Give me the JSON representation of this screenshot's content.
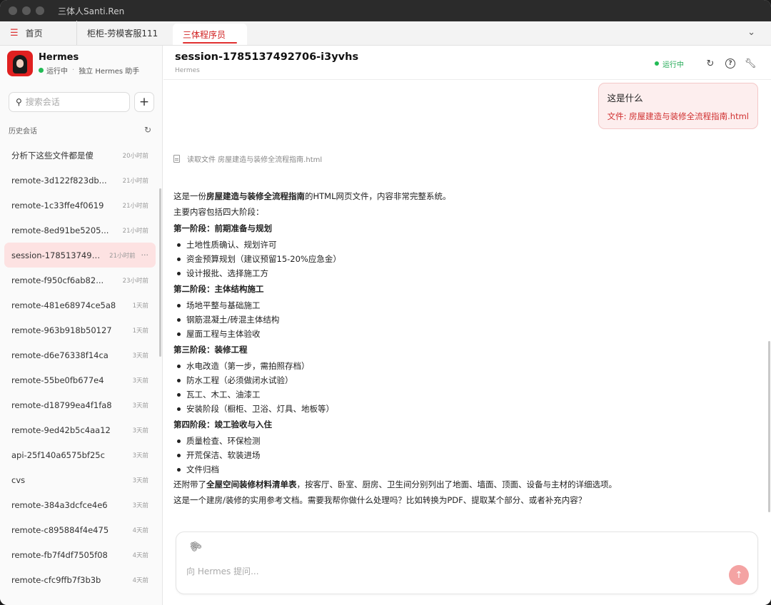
{
  "window": {
    "title": "三体人Santi.Ren"
  },
  "tabs": [
    {
      "label": "首页"
    },
    {
      "label": "柜柜-劳模客服111"
    },
    {
      "label": "三体程序员"
    }
  ],
  "app": {
    "name": "Hermes",
    "status": "运行中",
    "role": "独立 Hermes 助手"
  },
  "search": {
    "placeholder": "搜索会话"
  },
  "history": {
    "title": "历史会话",
    "sessions": [
      {
        "name": "分析下这些文件都是傻",
        "time": "20小时前"
      },
      {
        "name": "remote-3d122f823db...",
        "time": "21小时前"
      },
      {
        "name": "remote-1c33ffe4f0619",
        "time": "21小时前"
      },
      {
        "name": "remote-8ed91be5205...",
        "time": "21小时前"
      },
      {
        "name": "session-17851374927...",
        "time": "21小时前",
        "active": true
      },
      {
        "name": "remote-f950cf6ab82...",
        "time": "23小时前"
      },
      {
        "name": "remote-481e68974ce5a8",
        "time": "1天前"
      },
      {
        "name": "remote-963b918b50127",
        "time": "1天前"
      },
      {
        "name": "remote-d6e76338f14ca",
        "time": "3天前"
      },
      {
        "name": "remote-55be0fb677e4",
        "time": "3天前"
      },
      {
        "name": "remote-d18799ea4f1fa8",
        "time": "3天前"
      },
      {
        "name": "remote-9ed42b5c4aa12",
        "time": "3天前"
      },
      {
        "name": "api-25f140a6575bf25c",
        "time": "3天前"
      },
      {
        "name": "cvs",
        "time": "3天前"
      },
      {
        "name": "remote-384a3dcfce4e6",
        "time": "3天前"
      },
      {
        "name": "remote-c895884f4e475",
        "time": "4天前"
      },
      {
        "name": "remote-fb7f4df7505f08",
        "time": "4天前"
      },
      {
        "name": "remote-cfc9ffb7f3b3b",
        "time": "4天前"
      }
    ]
  },
  "session": {
    "title": "session-1785137492706-i3yvhs",
    "subtitle": "Hermes",
    "status": "运行中"
  },
  "chat": {
    "user_message": "这是什么",
    "user_file": "文件: 房屋建造与装修全流程指南.html",
    "tool_call": "读取文件 房屋建造与装修全流程指南.html",
    "answer": {
      "intro_pre": "这是一份",
      "intro_bold": "房屋建造与装修全流程指南",
      "intro_post": "的HTML网页文件，内容非常完整系统。",
      "summary": "主要内容包括四大阶段：",
      "stages": [
        {
          "title": "第一阶段：前期准备与规划",
          "items": [
            "土地性质确认、规划许可",
            "资金预算规划（建议预留15-20%应急金）",
            "设计报批、选择施工方"
          ]
        },
        {
          "title": "第二阶段：主体结构施工",
          "items": [
            "场地平整与基础施工",
            "钢筋混凝土/砖混主体结构",
            "屋面工程与主体验收"
          ]
        },
        {
          "title": "第三阶段：装修工程",
          "items": [
            "水电改造（第一步，需拍照存档）",
            "防水工程（必须做闭水试验）",
            "瓦工、木工、油漆工",
            "安装阶段（橱柜、卫浴、灯具、地板等）"
          ]
        },
        {
          "title": "第四阶段：竣工验收与入住",
          "items": [
            "质量检查、环保检测",
            "开荒保洁、软装进场",
            "文件归档"
          ]
        }
      ],
      "extra_pre": "还附带了",
      "extra_bold": "全屋空间装修材料清单表",
      "extra_post": "，按客厅、卧室、厨房、卫生间分别列出了地面、墙面、顶面、设备与主材的详细选项。",
      "closing": "这是一个建房/装修的实用参考文档。需要我帮你做什么处理吗？比如转换为PDF、提取某个部分、或者补充内容？"
    }
  },
  "composer": {
    "placeholder": "向 Hermes 提问..."
  },
  "colors": {
    "accent": "#e03030",
    "running": "#22aa55",
    "active_session_bg": "#fde2e2",
    "send_button": "#f4a3a3"
  },
  "icons": [
    "menu-icon",
    "chevron-down-icon",
    "search-icon",
    "plus-icon",
    "refresh-icon",
    "more-icon",
    "reload-icon",
    "help-icon",
    "wrench-icon",
    "file-icon",
    "paperclip-icon",
    "send-arrow-icon"
  ]
}
